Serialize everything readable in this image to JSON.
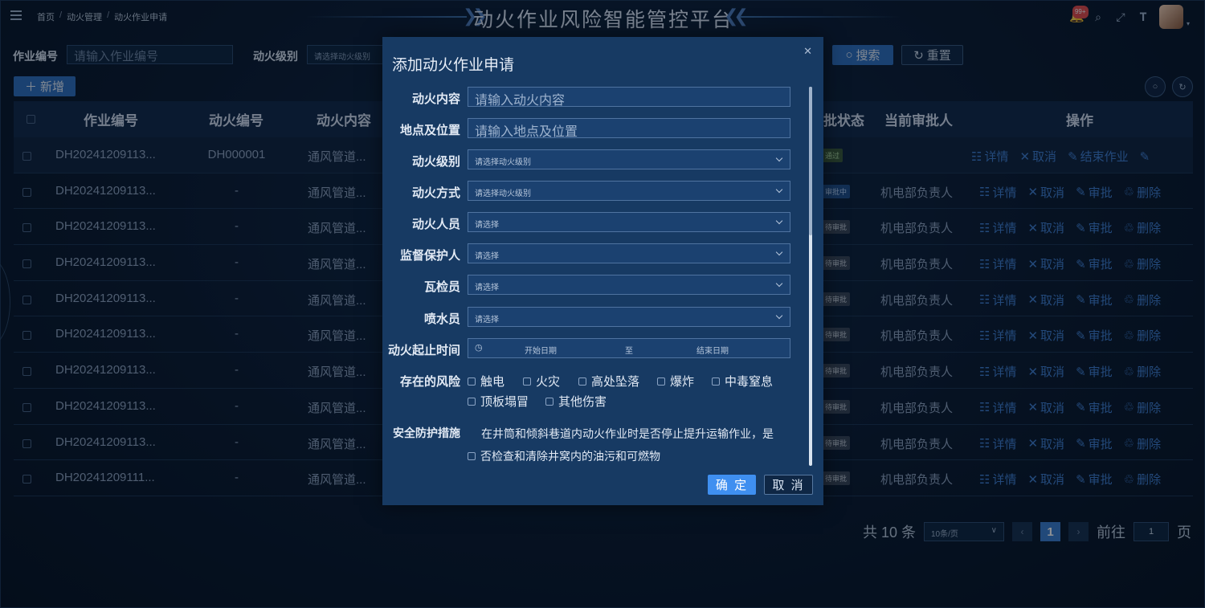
{
  "header": {
    "title": "动火作业风险智能管控平台",
    "breadcrumb": [
      "首页",
      "动火管理",
      "动火作业申请"
    ],
    "notification_badge": "99+"
  },
  "filters": {
    "job_no_label": "作业编号",
    "job_no_placeholder": "请输入作业编号",
    "fire_level_label": "动火级别",
    "fire_level_placeholder": "请选择动火级别",
    "search_label": "搜索",
    "reset_label": "重置"
  },
  "toolbar": {
    "add_label": "新增"
  },
  "table": {
    "headers": {
      "job_no": "作业编号",
      "fire_no": "动火编号",
      "content": "动火内容",
      "status": "批状态",
      "approver": "当前审批人",
      "ops": "操作"
    },
    "rows": [
      {
        "job_no": "DH20241209113...",
        "fire_no": "DH000001",
        "content": "通风管道...",
        "status": "通过",
        "status_kind": "ok",
        "approver": "",
        "ops": [
          "详情",
          "取消",
          "结束作业"
        ]
      },
      {
        "job_no": "DH20241209113...",
        "fire_no": "-",
        "content": "通风管道...",
        "status": "审批中",
        "status_kind": "ing",
        "approver": "机电部负责人",
        "ops": [
          "详情",
          "取消",
          "审批",
          "删除"
        ]
      },
      {
        "job_no": "DH20241209113...",
        "fire_no": "-",
        "content": "通风管道...",
        "status": "待审批",
        "status_kind": "wait",
        "approver": "机电部负责人",
        "ops": [
          "详情",
          "取消",
          "审批",
          "删除"
        ]
      },
      {
        "job_no": "DH20241209113...",
        "fire_no": "-",
        "content": "通风管道...",
        "status": "待审批",
        "status_kind": "wait",
        "approver": "机电部负责人",
        "ops": [
          "详情",
          "取消",
          "审批",
          "删除"
        ]
      },
      {
        "job_no": "DH20241209113...",
        "fire_no": "-",
        "content": "通风管道...",
        "status": "待审批",
        "status_kind": "wait",
        "approver": "机电部负责人",
        "ops": [
          "详情",
          "取消",
          "审批",
          "删除"
        ]
      },
      {
        "job_no": "DH20241209113...",
        "fire_no": "-",
        "content": "通风管道...",
        "status": "待审批",
        "status_kind": "wait",
        "approver": "机电部负责人",
        "ops": [
          "详情",
          "取消",
          "审批",
          "删除"
        ]
      },
      {
        "job_no": "DH20241209113...",
        "fire_no": "-",
        "content": "通风管道...",
        "status": "待审批",
        "status_kind": "wait",
        "approver": "机电部负责人",
        "ops": [
          "详情",
          "取消",
          "审批",
          "删除"
        ]
      },
      {
        "job_no": "DH20241209113...",
        "fire_no": "-",
        "content": "通风管道...",
        "status": "待审批",
        "status_kind": "wait",
        "approver": "机电部负责人",
        "ops": [
          "详情",
          "取消",
          "审批",
          "删除"
        ]
      },
      {
        "job_no": "DH20241209113...",
        "fire_no": "-",
        "content": "通风管道...",
        "status": "待审批",
        "status_kind": "wait",
        "approver": "机电部负责人",
        "ops": [
          "详情",
          "取消",
          "审批",
          "删除"
        ]
      },
      {
        "job_no": "DH20241209111...",
        "fire_no": "-",
        "content": "通风管道...",
        "status": "待审批",
        "status_kind": "wait",
        "approver": "机电部负责人",
        "ops": [
          "详情",
          "取消",
          "审批",
          "删除"
        ]
      }
    ]
  },
  "pagination": {
    "total_text": "共 10 条",
    "page_size": "10条/页",
    "current_page": "1",
    "goto_label": "前往",
    "goto_value": "1",
    "page_unit": "页"
  },
  "modal": {
    "title": "添加动火作业申请",
    "fields": {
      "content_label": "动火内容",
      "content_placeholder": "请输入动火内容",
      "location_label": "地点及位置",
      "location_placeholder": "请输入地点及位置",
      "level_label": "动火级别",
      "level_placeholder": "请选择动火级别",
      "method_label": "动火方式",
      "method_placeholder": "请选择动火级别",
      "personnel_label": "动火人员",
      "personnel_placeholder": "请选择",
      "guardian_label": "监督保护人",
      "guardian_placeholder": "请选择",
      "gas_checker_label": "瓦检员",
      "gas_checker_placeholder": "请选择",
      "sprinkler_label": "喷水员",
      "sprinkler_placeholder": "请选择",
      "time_label": "动火起止时间",
      "start_placeholder": "开始日期",
      "range_sep": "至",
      "end_placeholder": "结束日期",
      "risk_label": "存在的风险",
      "risks": [
        "触电",
        "火灾",
        "高处坠落",
        "爆炸",
        "中毒窒息",
        "顶板塌冒",
        "其他伤害"
      ],
      "safety_label": "安全防护措施",
      "safety_line1": "在井筒和倾斜巷道内动火作业时是否停止提升运输作业，是",
      "safety_line2": "否检查和清除井窝内的油污和可燃物"
    },
    "ok_label": "确 定",
    "cancel_label": "取 消"
  }
}
